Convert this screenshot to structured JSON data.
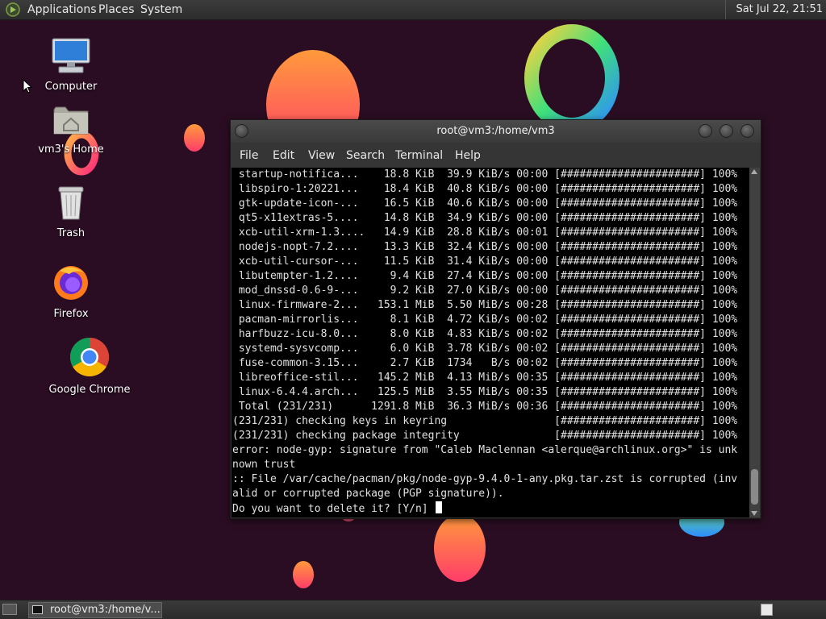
{
  "top_panel": {
    "menus": [
      "Applications",
      "Places",
      "System"
    ],
    "clock": "Sat Jul 22, 21:51"
  },
  "desktop_icons": [
    {
      "label": "Computer",
      "icon": "computer-icon"
    },
    {
      "label": "vm3's Home",
      "icon": "home-folder-icon"
    },
    {
      "label": "Trash",
      "icon": "trash-icon"
    },
    {
      "label": "Firefox",
      "icon": "firefox-icon"
    },
    {
      "label": "Google Chrome",
      "icon": "chrome-icon"
    }
  ],
  "terminal": {
    "title": "root@vm3:/home/vm3",
    "menus": [
      "File",
      "Edit",
      "View",
      "Search",
      "Terminal",
      "Help"
    ],
    "lines": [
      " startup-notifica...    18.8 KiB  39.9 KiB/s 00:00 [######################] 100%",
      " libspiro-1:20221...    18.4 KiB  40.8 KiB/s 00:00 [######################] 100%",
      " gtk-update-icon-...    16.5 KiB  40.6 KiB/s 00:00 [######################] 100%",
      " qt5-x11extras-5....    14.8 KiB  34.9 KiB/s 00:00 [######################] 100%",
      " xcb-util-xrm-1.3....   14.9 KiB  28.8 KiB/s 00:01 [######################] 100%",
      " nodejs-nopt-7.2....    13.3 KiB  32.4 KiB/s 00:00 [######################] 100%",
      " xcb-util-cursor-...    11.5 KiB  31.4 KiB/s 00:00 [######################] 100%",
      " libutempter-1.2....     9.4 KiB  27.4 KiB/s 00:00 [######################] 100%",
      " mod_dnssd-0.6-9-...     9.2 KiB  27.0 KiB/s 00:00 [######################] 100%",
      " linux-firmware-2...   153.1 MiB  5.50 MiB/s 00:28 [######################] 100%",
      " pacman-mirrorlis...     8.1 KiB  4.72 KiB/s 00:02 [######################] 100%",
      " harfbuzz-icu-8.0...     8.0 KiB  4.83 KiB/s 00:02 [######################] 100%",
      " systemd-sysvcomp...     6.0 KiB  3.78 KiB/s 00:02 [######################] 100%",
      " fuse-common-3.15...     2.7 KiB  1734   B/s 00:02 [######################] 100%",
      " libreoffice-stil...   145.2 MiB  4.13 MiB/s 00:35 [######################] 100%",
      " linux-6.4.4.arch...   125.5 MiB  3.55 MiB/s 00:35 [######################] 100%",
      " Total (231/231)      1291.8 MiB  36.3 MiB/s 00:36 [######################] 100%",
      "(231/231) checking keys in keyring                 [######################] 100%",
      "(231/231) checking package integrity               [######################] 100%",
      "error: node-gyp: signature from \"Caleb Maclennan <alerque@archlinux.org>\" is unk",
      "nown trust",
      ":: File /var/cache/pacman/pkg/node-gyp-9.4.0-1-any.pkg.tar.zst is corrupted (inv",
      "alid or corrupted package (PGP signature)).",
      "Do you want to delete it? [Y/n] "
    ]
  },
  "taskbar": {
    "window_label": "root@vm3:/home/v..."
  }
}
